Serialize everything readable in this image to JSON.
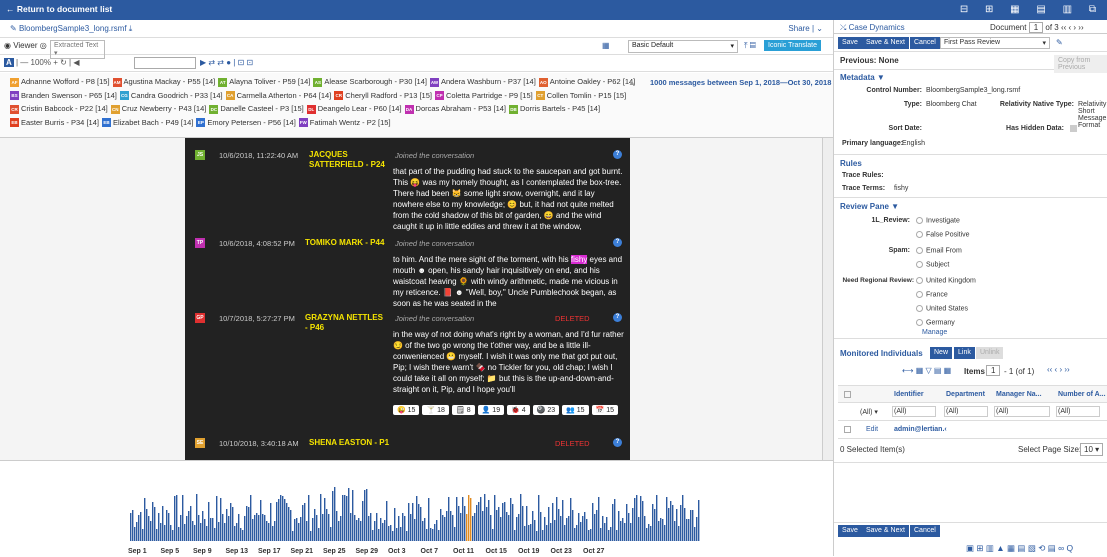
{
  "topbar": {
    "back": "← Return to document list",
    "icons": "⊟ ⊞ ▦ ▤ ▥ ⧉"
  },
  "doc": {
    "name": "BloombergSample3_long.rsmf",
    "share": "Share",
    "viewer": "Viewer",
    "viewmode": "Extracted Text",
    "zoom": "100%",
    "layout": "Basic Default",
    "translate": "Iconic Translate"
  },
  "participants": [
    {
      "i": "AF",
      "c": "#f0a030",
      "n": "Adnanne Wofford - P8 [15]"
    },
    {
      "i": "AM",
      "c": "#e05030",
      "n": "Agustina Mackay - P55 [14]"
    },
    {
      "i": "AT",
      "c": "#70b030",
      "n": "Alayna Toliver - P59 [14]"
    },
    {
      "i": "AS",
      "c": "#70b030",
      "n": "Alease Scarborough - P30 [14]"
    },
    {
      "i": "AW",
      "c": "#8040c0",
      "n": "Andera Washburn - P37 [14]"
    },
    {
      "i": "AO",
      "c": "#e06030",
      "n": "Antoine Oakley - P62 [14]"
    },
    {
      "i": "BS",
      "c": "#8040c0",
      "n": "Branden Swenson - P65 [14]"
    },
    {
      "i": "CG",
      "c": "#30a0d0",
      "n": "Candra Goodrich - P33 [14]"
    },
    {
      "i": "CA",
      "c": "#e0a030",
      "n": "Carmella Atherton - P64 [14]"
    },
    {
      "i": "CR",
      "c": "#e04020",
      "n": "Cheryll Radford - P13 [15]"
    },
    {
      "i": "CP",
      "c": "#c030b0",
      "n": "Coletta Partridge - P9 [15]"
    },
    {
      "i": "CT",
      "c": "#e0a030",
      "n": "Collen Tomlin - P15 [15]"
    },
    {
      "i": "CR",
      "c": "#e05030",
      "n": "Cristin Babcock - P22 [14]"
    },
    {
      "i": "CN",
      "c": "#e0a030",
      "n": "Cruz Newberry - P43 [14]"
    },
    {
      "i": "DC",
      "c": "#70b030",
      "n": "Danelle Casteel - P3 [15]"
    },
    {
      "i": "DL",
      "c": "#e03030",
      "n": "Deangelo Lear - P60 [14]"
    },
    {
      "i": "DA",
      "c": "#c030b0",
      "n": "Dorcas Abraham - P53 [14]"
    },
    {
      "i": "DB",
      "c": "#70b030",
      "n": "Dorris Bartels - P45 [14]"
    },
    {
      "i": "EB",
      "c": "#e04020",
      "n": "Easter Burris - P34 [14]"
    },
    {
      "i": "EB",
      "c": "#3070d0",
      "n": "Elizabet Bach - P49 [14]"
    },
    {
      "i": "EP",
      "c": "#3070d0",
      "n": "Emory Petersen - P56 [14]"
    },
    {
      "i": "FW",
      "c": "#8040c0",
      "n": "Fatimah Wentz - P2 [15]"
    }
  ],
  "msgsum": "1000 messages between Sep 1, 2018—Oct 30, 2018",
  "messages": [
    {
      "i": "JS",
      "c": "#70b030",
      "ts": "10/6/2018, 11:22:40 AM",
      "name": "JACQUES SATTERFIELD - P24",
      "act": "Joined the conversation",
      "del": "",
      "body": "that part of the pudding had stuck to the saucepan and got burnt. This 😝 was my homely thought, as I contemplated the box-tree. There had been 😸 some light snow, overnight, and it lay nowhere else to my knowledge; 😊 but, it had not quite melted from the cold shadow of this bit of garden, 😄 and the wind caught it up in little eddies and threw it at the window,"
    },
    {
      "i": "TP",
      "c": "#c030b0",
      "ts": "10/6/2018, 4:08:52 PM",
      "name": "TOMIKO MARK - P44",
      "act": "Joined the conversation",
      "del": "",
      "body_a": "to him. And the mere sight of the torment, with his ",
      "hl": "fishy",
      "body_b": " eyes and mouth ☻ open, his sandy hair inquisitively on end, and his waistcoat heaving 🌻 with windy arithmetic, made me vicious in my reticence. 📕 ☻ \"Well, boy,\" Uncle Pumblechook began, as soon as he was seated in the"
    },
    {
      "i": "GP",
      "c": "#e03030",
      "ts": "10/7/2018, 5:27:27 PM",
      "name": "GRAZYNA NETTLES - P46",
      "act": "Joined the conversation",
      "del": "DELETED",
      "body": "in the way of not doing what's right by a woman, and I'd fur rather 😏 of the two go wrong the t'other way, and be a little ill-conwenienced 😬 myself. I wish it was only me that got put out, Pip; I wish there warn't 🍫 no Tickler for you, old chap; I wish I could take it all on myself; 📁 but this is the up-and-down-and-straight on it, Pip, and I hope you'll"
    },
    {
      "i": "SE",
      "c": "#e0a030",
      "ts": "10/10/2018, 3:40:18 AM",
      "name": "SHENA EASTON - P1",
      "act": "",
      "del": "DELETED"
    }
  ],
  "reactions": [
    "😜 15",
    "🍸 18",
    "🗒 8",
    "👤 19",
    "🐞 4",
    "🎱 23",
    "👥 15",
    "📅 15"
  ],
  "timeline": {
    "labels": [
      "Sep 1",
      "Sep 5",
      "Sep 9",
      "Sep 13",
      "Sep 17",
      "Sep 21",
      "Sep 25",
      "Sep 29",
      "Oct 3",
      "Oct 7",
      "Oct 11",
      "Oct 15",
      "Oct 19",
      "Oct 23",
      "Oct 27"
    ]
  },
  "right": {
    "title": "Case Dynamics",
    "doclbl": "Document",
    "docnum": "1",
    "docof": "of 3",
    "save": "Save",
    "savenext": "Save & Next",
    "cancel": "Cancel",
    "review": "First Pass Review",
    "previous": "Previous: None",
    "copy": "Copy from Previous",
    "metadata": "Metadata ▼",
    "control_lbl": "Control Number:",
    "control": "BloombergSample3_long.rsmf",
    "type_lbl": "Type:",
    "type": "Bloomberg Chat",
    "rnt_lbl": "Relativity Native Type:",
    "rnt": "Relativity Short Message Format",
    "sort_lbl": "Sort Date:",
    "hidden_lbl": "Has Hidden Data:",
    "lang_lbl": "Primary language:",
    "lang": "English",
    "rules": "Rules",
    "trace_rules": "Trace Rules:",
    "trace_terms": "Trace Terms:",
    "terms": "fishy",
    "pane": "Review Pane ▼",
    "l1": "1L_Review:",
    "investigate": "Investigate",
    "falsepos": "False Positive",
    "spam": "Spam:",
    "email": "Email From",
    "subject": "Subject",
    "region": "Need Regional Review:",
    "uk": "United Kingdom",
    "fr": "France",
    "us": "United States",
    "de": "Germany",
    "manage": "Manage",
    "monitored": "Monitored Individuals",
    "new": "New",
    "link": "Link",
    "unlink": "Unlink",
    "items": "Items",
    "page": "1",
    "of": "- 1 (of 1)",
    "cols": [
      "Identifier",
      "Department",
      "Manager Na...",
      "Number of A..."
    ],
    "all": "(All)",
    "edit": "Edit",
    "admin": "admin@lertian.‹",
    "selected": "0 Selected Item(s)",
    "pagesize": "Select Page Size:",
    "ps": "10",
    "footicons": "▣ ⊞ ▥ ▲ ▦ ▤ ▧ ⟲ ▤ ∞ Q"
  }
}
